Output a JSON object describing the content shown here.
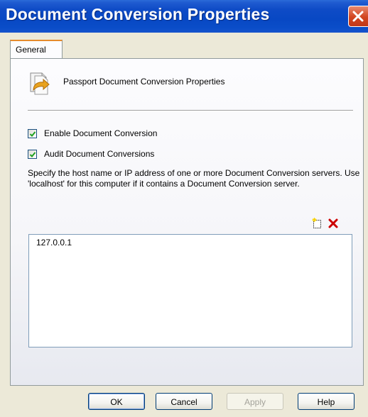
{
  "window": {
    "title": "Document Conversion Properties",
    "close_icon": "close-icon"
  },
  "tabs": [
    {
      "label": "General",
      "selected": true
    }
  ],
  "header": {
    "icon": "document-conversion-icon",
    "text": "Passport Document Conversion Properties"
  },
  "options": [
    {
      "label": "Enable Document Conversion",
      "checked": true
    },
    {
      "label": "Audit Document Conversions",
      "checked": true
    }
  ],
  "description": "Specify the host name or IP address of one or more Document Conversion servers.  Use 'localhost' for this computer if it contains a Document Conversion server.",
  "server_list": {
    "new_icon": "new-item-icon",
    "delete_icon": "delete-icon",
    "items": [
      "127.0.0.1"
    ]
  },
  "buttons": {
    "ok": "OK",
    "cancel": "Cancel",
    "apply": "Apply",
    "help": "Help"
  },
  "colors": {
    "titlebar": "#0848c4",
    "close": "#d2451f",
    "delete": "#cc0000"
  }
}
